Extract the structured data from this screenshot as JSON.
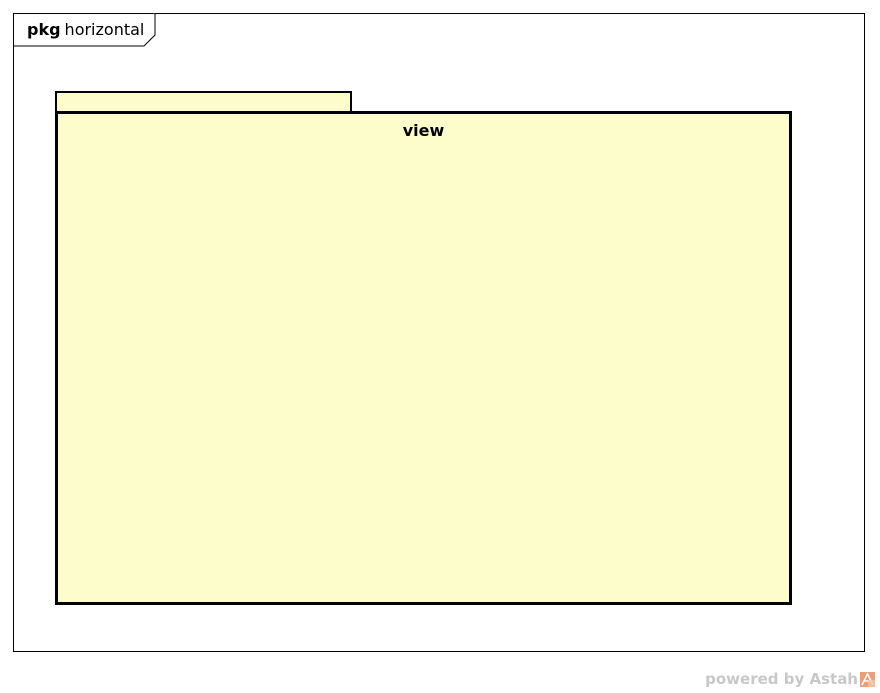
{
  "frame": {
    "keyword": "pkg",
    "name": "horizontal"
  },
  "package": {
    "name": "view"
  },
  "watermark": {
    "text": "powered by Astah"
  },
  "colors": {
    "package_fill": "#fdfdcc",
    "border": "#000000",
    "watermark_text": "#c8c8c8",
    "watermark_icon": "#e8a07a"
  }
}
